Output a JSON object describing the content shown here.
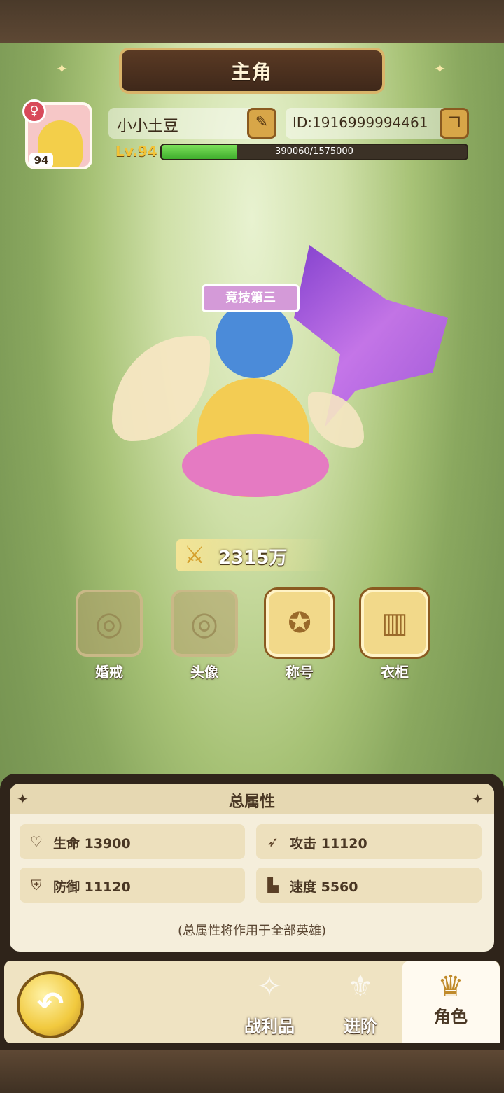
{
  "screen": {
    "title": "主角"
  },
  "profile": {
    "avatar_level": "94",
    "name": "小小土豆",
    "id": "ID:1916999994461",
    "level": "Lv.94",
    "xp_current": 390060,
    "xp_max": 1575000,
    "xp_text": "390060/1575000",
    "gender_icon": "female-icon"
  },
  "hero": {
    "title_badge": "竞技第三"
  },
  "power": {
    "value": "2315万",
    "icon": "sword-shield-icon"
  },
  "slots": [
    {
      "label": "婚戒",
      "icon": "ring-icon",
      "active": false
    },
    {
      "label": "头像",
      "icon": "portrait-icon",
      "active": false
    },
    {
      "label": "称号",
      "icon": "title-icon",
      "active": true
    },
    {
      "label": "衣柜",
      "icon": "wardrobe-icon",
      "active": true
    }
  ],
  "stats": {
    "title": "总属性",
    "items": [
      {
        "label": "生命 13900",
        "icon": "heart-icon"
      },
      {
        "label": "攻击 11120",
        "icon": "attack-icon"
      },
      {
        "label": "防御 11120",
        "icon": "shield-icon"
      },
      {
        "label": "速度 5560",
        "icon": "boot-icon"
      }
    ],
    "note": "(总属性将作用于全部英雄)"
  },
  "nav": {
    "back_icon": "back-arrow-icon",
    "tabs": [
      {
        "label": "战利品",
        "icon": "loot-icon",
        "active": false
      },
      {
        "label": "进阶",
        "icon": "advance-icon",
        "active": false
      },
      {
        "label": "角色",
        "icon": "character-icon",
        "active": true
      }
    ]
  },
  "colors": {
    "accent_gold": "#d8a648",
    "xp_green": "#3fae2d",
    "panel_bg": "#f5eedb",
    "frame_brown": "#2f241a"
  }
}
